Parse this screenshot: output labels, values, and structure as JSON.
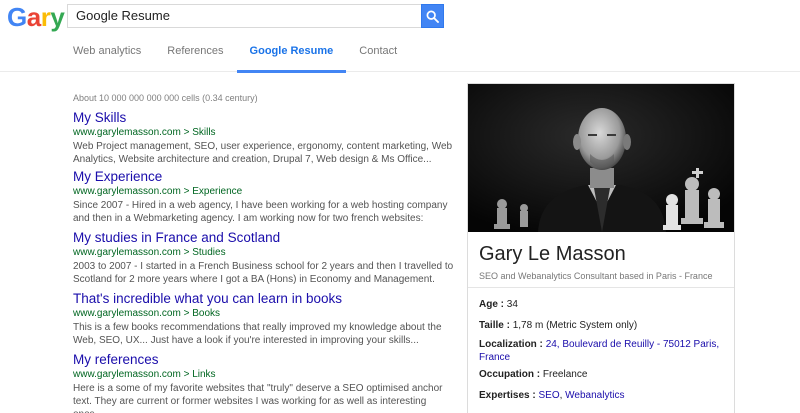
{
  "logo": {
    "letters": [
      "G",
      "a",
      "r",
      "y"
    ],
    "colors": [
      "#4285f4",
      "#ea4335",
      "#fbbc05",
      "#34a853"
    ]
  },
  "search": {
    "value": "Google Resume",
    "icon": "search-icon"
  },
  "tabs": [
    {
      "label": "Web analytics"
    },
    {
      "label": "References"
    },
    {
      "label": "Google Resume"
    },
    {
      "label": "Contact"
    }
  ],
  "stats": "About 10 000 000 000 000 cells (0.34 century)",
  "results": [
    {
      "title": "My Skills",
      "url": "www.garylemasson.com > Skills",
      "snippet": "Web Project management, SEO, user experience, ergonomy, content marketing, Web Analytics, Website architecture and creation, Drupal 7, Web design & Ms Office..."
    },
    {
      "title": "My Experience",
      "url": "www.garylemasson.com > Experience",
      "snippet": "Since 2007 - Hired in a web agency, I have been working for a web hosting company and then in a Webmarketing agency. I am working now for two french websites:"
    },
    {
      "title": "My studies in France and Scotland",
      "url": "www.garylemasson.com > Studies",
      "snippet": "2003 to 2007 - I started in a French Business school for 2 years and then I travelled to Scotland for 2 more years where I got a BA (Hons) in Economy and Management."
    },
    {
      "title": "That's incredible what you can learn in books",
      "url": "www.garylemasson.com > Books",
      "snippet": "This is a few books recommendations that really improved my knowledge about the Web, SEO, UX... Just have a look if you're interested in improving your skills..."
    },
    {
      "title": "My references",
      "url": "www.garylemasson.com > Links",
      "snippet": "Here is a some of my favorite websites that \"truly\" deserve a SEO optimised anchor text. They are current or former websites I was working for as well as interesting ones..."
    }
  ],
  "panel": {
    "name": "Gary Le Masson",
    "subtitle": "SEO and Webanalytics Consultant based in Paris - France",
    "age_label": "Age :",
    "age": "34",
    "height_label": "Taille :",
    "height": "1,78 m (Metric System only)",
    "location_label": "Localization :",
    "location": "24, Boulevard de Reuilly - 75012 Paris, France",
    "occupation_label": "Occupation :",
    "occupation": "Freelance",
    "expertise_label": "Expertises :",
    "expertise_1": "SEO",
    "expertise_sep": ",",
    "expertise_2": "Webanalytics"
  }
}
